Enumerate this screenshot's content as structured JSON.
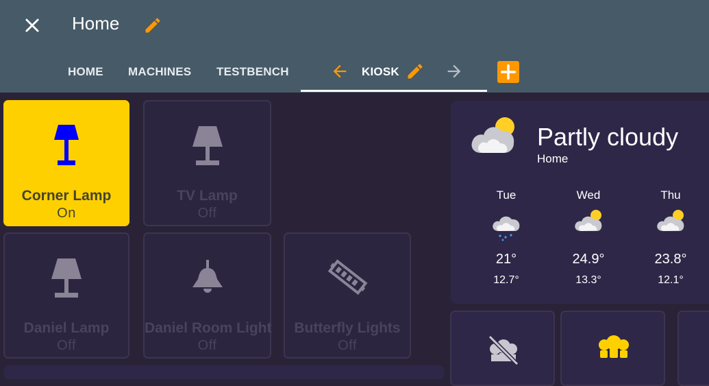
{
  "header": {
    "title": "Home",
    "tabs": [
      {
        "label": "HOME"
      },
      {
        "label": "MACHINES"
      },
      {
        "label": "TESTBENCH"
      },
      {
        "label": "KIOSK",
        "active": true
      }
    ],
    "accent": "#ff9800",
    "bg": "#465a67"
  },
  "tiles": [
    {
      "name": "Corner Lamp",
      "state": "On",
      "icon": "lamp-icon"
    },
    {
      "name": "TV Lamp",
      "state": "Off",
      "icon": "lamp-icon"
    },
    {
      "name": "Daniel Lamp",
      "state": "Off",
      "icon": "lamp-icon"
    },
    {
      "name": "Daniel Room Light",
      "state": "Off",
      "icon": "ceiling-light-icon"
    },
    {
      "name": "Butterfly Lights",
      "state": "Off",
      "icon": "led-strip-icon"
    }
  ],
  "weather": {
    "condition": "Partly cloudy",
    "location": "Home",
    "forecast": [
      {
        "day": "Tue",
        "high": "21°",
        "low": "12.7°",
        "icon": "rainy-partly-cloudy-icon"
      },
      {
        "day": "Wed",
        "high": "24.9°",
        "low": "13.3°",
        "icon": "partly-cloudy-icon"
      },
      {
        "day": "Thu",
        "high": "23.8°",
        "low": "12.1°",
        "icon": "partly-cloudy-icon"
      }
    ]
  },
  "extra_tiles": [
    {
      "icon": "lightbulb-group-off-icon"
    },
    {
      "icon": "lightbulb-group-icon"
    }
  ],
  "colors": {
    "on": "#ffd000",
    "off_icon": "#8b8396",
    "lamp_on": "#0000ff"
  }
}
